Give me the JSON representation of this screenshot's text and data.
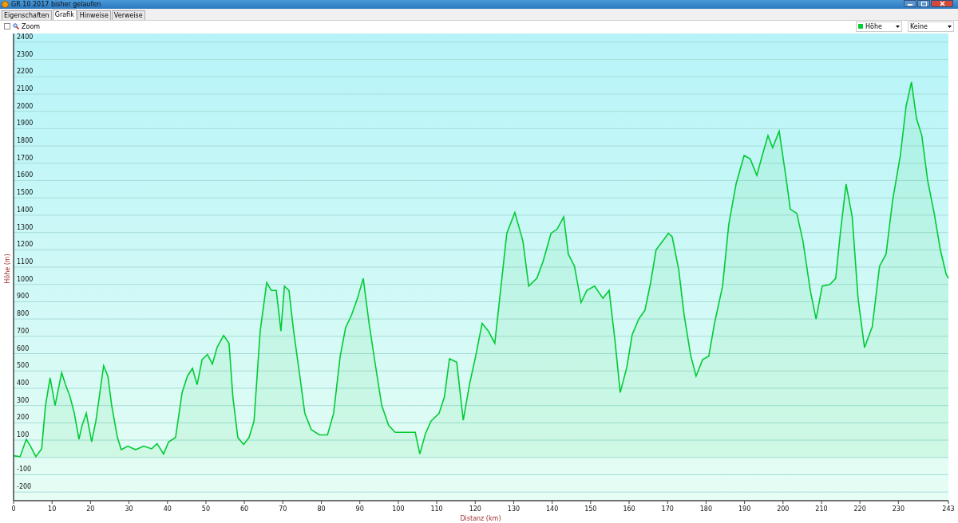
{
  "window": {
    "title": "GR 10 2017 bisher gelaufen"
  },
  "tabs": [
    {
      "label": "Eigenschaften",
      "selected": false
    },
    {
      "label": "Grafik",
      "selected": true
    },
    {
      "label": "Hinweise",
      "selected": false
    },
    {
      "label": "Verweise",
      "selected": false
    }
  ],
  "toolbar": {
    "zoom": {
      "label": "Zoom",
      "checked": false
    },
    "series_select": {
      "color": "#00cc33"
    },
    "second_select": {
      "value": "Keine"
    }
  },
  "chart": {
    "chart_data": {
      "type": "area",
      "xlabel": "Distanz  (km)",
      "ylabel": "Höhe (m)",
      "xlim": [
        0,
        243
      ],
      "ylim": [
        -250,
        2450
      ],
      "grid": true,
      "xticks": [
        0,
        10,
        20,
        30,
        40,
        50,
        60,
        70,
        80,
        90,
        100,
        110,
        120,
        130,
        140,
        150,
        160,
        170,
        180,
        190,
        200,
        210,
        220,
        230,
        243
      ],
      "yticks": [
        -200,
        -100,
        100,
        200,
        300,
        400,
        500,
        600,
        700,
        800,
        900,
        1000,
        1100,
        1200,
        1300,
        1400,
        1500,
        1600,
        1700,
        1800,
        1900,
        2000,
        2100,
        2200,
        2300,
        2400
      ],
      "x": [
        0,
        1.7,
        3.3,
        4.4,
        5.8,
        7.3,
        8.3,
        9.5,
        10.8,
        12.5,
        13.5,
        14.7,
        15.8,
        17,
        17.8,
        18.9,
        20.3,
        21.4,
        22.6,
        23.4,
        24.5,
        25.5,
        27,
        28,
        29.7,
        31.7,
        33.8,
        35.9,
        37.3,
        39,
        40.3,
        42.1,
        43.8,
        45.2,
        46.5,
        47.7,
        49,
        50.4,
        51.7,
        52.9,
        54.6,
        56,
        57,
        58.3,
        59.8,
        61.2,
        62.5,
        64.1,
        65.8,
        67,
        68.3,
        69.5,
        70.4,
        71.6,
        72.8,
        74.3,
        75.7,
        77.4,
        79.5,
        81.6,
        83.2,
        84.9,
        86.3,
        87.8,
        89.4,
        90.9,
        92.4,
        94,
        95.7,
        97.5,
        99.2,
        101.3,
        104.4,
        105.6,
        107.1,
        108.5,
        110.6,
        112,
        113.3,
        115.2,
        116.9,
        118.5,
        120.1,
        121.8,
        123.4,
        125.1,
        126.7,
        128.2,
        130.3,
        132.4,
        133.9,
        136,
        137.6,
        139.7,
        141.3,
        143,
        144.2,
        145.8,
        147.5,
        149,
        151,
        153.2,
        154.8,
        156.3,
        157.7,
        159.4,
        160.8,
        162.5,
        164.1,
        165.6,
        167,
        168.7,
        170.2,
        171.2,
        172.9,
        174.3,
        176,
        177.4,
        179.1,
        180.7,
        182.2,
        184.3,
        185.9,
        187.8,
        189.9,
        191.5,
        193.2,
        194.6,
        196.1,
        197.3,
        199,
        200.9,
        201.9,
        203.6,
        205.2,
        207.1,
        208.6,
        210.2,
        212.2,
        213.7,
        214.9,
        216.4,
        218,
        219.5,
        221.2,
        223.2,
        225.1,
        226.8,
        228.5,
        230.5,
        232,
        233.4,
        234.7,
        236.1,
        237.6,
        239.3,
        240.9,
        242.4,
        243
      ],
      "series": [
        {
          "name": "Höhe",
          "color": "#00cc33",
          "values": [
            10,
            5,
            105,
            65,
            5,
            50,
            300,
            460,
            300,
            490,
            420,
            350,
            255,
            105,
            185,
            255,
            90,
            210,
            400,
            530,
            470,
            300,
            115,
            45,
            65,
            45,
            65,
            50,
            80,
            20,
            90,
            115,
            375,
            470,
            515,
            420,
            565,
            595,
            540,
            635,
            705,
            660,
            350,
            115,
            75,
            115,
            210,
            730,
            1010,
            965,
            965,
            730,
            990,
            965,
            730,
            490,
            255,
            160,
            130,
            130,
            255,
            585,
            750,
            820,
            920,
            1035,
            775,
            540,
            300,
            185,
            145,
            145,
            145,
            20,
            140,
            210,
            255,
            350,
            570,
            550,
            215,
            420,
            585,
            775,
            730,
            660,
            990,
            1295,
            1415,
            1250,
            990,
            1035,
            1130,
            1295,
            1320,
            1390,
            1175,
            1105,
            895,
            965,
            990,
            920,
            965,
            680,
            375,
            520,
            710,
            800,
            850,
            1010,
            1200,
            1250,
            1295,
            1275,
            1085,
            825,
            590,
            470,
            565,
            585,
            775,
            990,
            1345,
            1580,
            1745,
            1725,
            1630,
            1745,
            1860,
            1790,
            1885,
            1600,
            1435,
            1410,
            1250,
            965,
            800,
            990,
            1000,
            1035,
            1295,
            1580,
            1390,
            920,
            635,
            755,
            1105,
            1175,
            1485,
            1745,
            2030,
            2170,
            1960,
            1860,
            1600,
            1410,
            1200,
            1060,
            1035
          ]
        }
      ]
    }
  }
}
